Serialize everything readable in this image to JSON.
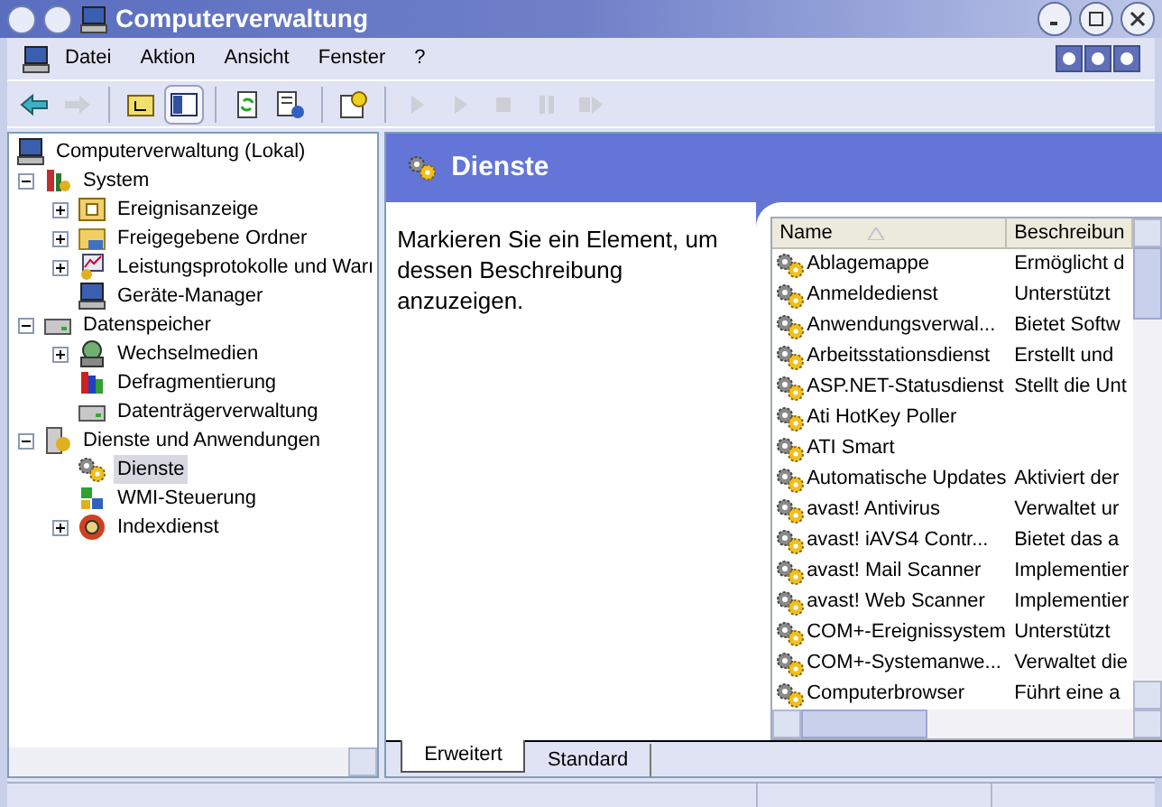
{
  "window": {
    "title": "Computerverwaltung"
  },
  "menu": [
    {
      "label": "Datei"
    },
    {
      "label": "Aktion"
    },
    {
      "label": "Ansicht"
    },
    {
      "label": "Fenster"
    },
    {
      "label": "?"
    }
  ],
  "toolbar": [
    {
      "kind": "back",
      "disabled": false,
      "pressed": false
    },
    {
      "kind": "forward",
      "disabled": true,
      "pressed": false
    },
    {
      "kind": "sep"
    },
    {
      "kind": "up",
      "disabled": false,
      "pressed": false
    },
    {
      "kind": "tree",
      "disabled": false,
      "pressed": true
    },
    {
      "kind": "sep"
    },
    {
      "kind": "refresh",
      "disabled": false,
      "pressed": false
    },
    {
      "kind": "export",
      "disabled": false,
      "pressed": false
    },
    {
      "kind": "sep"
    },
    {
      "kind": "help",
      "disabled": false,
      "pressed": false
    },
    {
      "kind": "sep"
    },
    {
      "kind": "play",
      "disabled": true,
      "pressed": false
    },
    {
      "kind": "play",
      "disabled": true,
      "pressed": false
    },
    {
      "kind": "stop",
      "disabled": true,
      "pressed": false
    },
    {
      "kind": "pause",
      "disabled": true,
      "pressed": false
    },
    {
      "kind": "restart",
      "disabled": true,
      "pressed": false
    }
  ],
  "tree": [
    {
      "label": "Computerverwaltung (Lokal)",
      "kind": "computer",
      "selected": false,
      "children": [
        {
          "label": "System",
          "kind": "tools",
          "expanded": true,
          "selected": false,
          "children": [
            {
              "label": "Ereignisanzeige",
              "kind": "log",
              "expanded": false,
              "selected": false
            },
            {
              "label": "Freigegebene Ordner",
              "kind": "folder",
              "expanded": false,
              "selected": false
            },
            {
              "label": "Leistungsprotokolle und Warı",
              "kind": "chart",
              "expanded": false,
              "selected": false
            },
            {
              "label": "Geräte-Manager",
              "kind": "computer",
              "selected": false
            }
          ]
        },
        {
          "label": "Datenspeicher",
          "kind": "drive",
          "expanded": true,
          "selected": false,
          "children": [
            {
              "label": "Wechselmedien",
              "kind": "disc",
              "expanded": false,
              "selected": false
            },
            {
              "label": "Defragmentierung",
              "kind": "defrag",
              "selected": false
            },
            {
              "label": "Datenträgerverwaltung",
              "kind": "drive",
              "selected": false
            }
          ]
        },
        {
          "label": "Dienste und Anwendungen",
          "kind": "server",
          "expanded": true,
          "selected": false,
          "children": [
            {
              "label": "Dienste",
              "kind": "gear",
              "selected": true
            },
            {
              "label": "WMI-Steuerung",
              "kind": "wmi",
              "selected": false
            },
            {
              "label": "Indexdienst",
              "kind": "index",
              "expanded": false,
              "selected": false
            }
          ]
        }
      ]
    }
  ],
  "pane": {
    "title": "Dienste",
    "hint": "Markieren Sie ein Element, um dessen Beschreibung anzuzeigen."
  },
  "table": {
    "columns": [
      {
        "label": "Name",
        "sorted": true
      },
      {
        "label": "Beschreibun"
      }
    ],
    "rows": [
      {
        "name": "Ablagemappe",
        "description": "Ermöglicht d"
      },
      {
        "name": "Anmeldedienst",
        "description": "Unterstützt"
      },
      {
        "name": "Anwendungsverwal...",
        "description": "Bietet Softw"
      },
      {
        "name": "Arbeitsstationsdienst",
        "description": "Erstellt und"
      },
      {
        "name": "ASP.NET-Statusdienst",
        "description": "Stellt die Unt"
      },
      {
        "name": "Ati HotKey Poller"
      },
      {
        "name": "ATI Smart"
      },
      {
        "name": "Automatische Updates",
        "description": "Aktiviert der"
      },
      {
        "name": "avast! Antivirus",
        "description": "Verwaltet ur"
      },
      {
        "name": "avast! iAVS4 Contr...",
        "description": "Bietet das a"
      },
      {
        "name": "avast! Mail Scanner",
        "description": "Implementier"
      },
      {
        "name": "avast! Web Scanner",
        "description": "Implementier"
      },
      {
        "name": "COM+-Ereignissystem",
        "description": "Unterstützt"
      },
      {
        "name": "COM+-Systemanwe...",
        "description": "Verwaltet die"
      },
      {
        "name": "Computerbrowser",
        "description": "Führt eine a"
      }
    ]
  },
  "tabs": [
    {
      "label": "Erweitert",
      "selected": true
    },
    {
      "label": "Standard",
      "selected": false
    }
  ]
}
